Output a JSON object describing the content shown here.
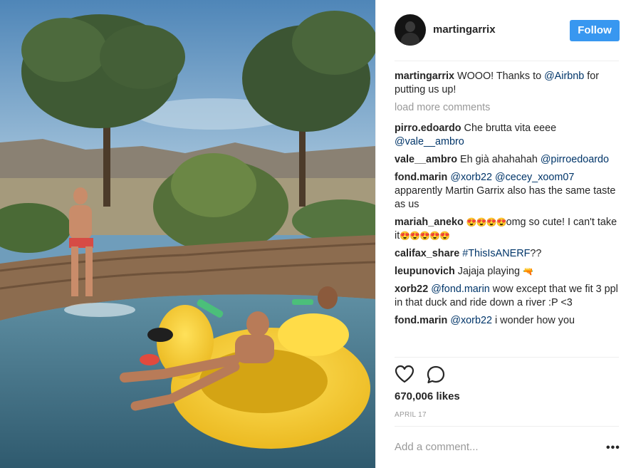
{
  "post": {
    "username": "martingarrix",
    "follow_label": "Follow",
    "caption": {
      "user": "martingarrix",
      "text_before": "WOOO! Thanks to ",
      "mention": "@Airbnb",
      "text_after": " for putting us up!"
    },
    "load_more": "load more comments",
    "comments": [
      {
        "user": "pirro.edoardo",
        "parts": [
          {
            "t": "text",
            "v": "Che brutta vita eeee "
          },
          {
            "t": "mention",
            "v": "@vale__ambro"
          }
        ]
      },
      {
        "user": "vale__ambro",
        "parts": [
          {
            "t": "text",
            "v": "Eh già ahahahah "
          },
          {
            "t": "mention",
            "v": "@pirroedoardo"
          }
        ]
      },
      {
        "user": "fond.marin",
        "parts": [
          {
            "t": "mention",
            "v": "@xorb22"
          },
          {
            "t": "text",
            "v": " "
          },
          {
            "t": "mention",
            "v": "@cecey_xoom07"
          },
          {
            "t": "text",
            "v": " apparently Martin Garrix also has the same taste as us"
          }
        ]
      },
      {
        "user": "mariah_aneko",
        "parts": [
          {
            "t": "emoji",
            "v": "😍😍😍😍"
          },
          {
            "t": "text",
            "v": "omg so cute! I can't take it"
          },
          {
            "t": "emoji",
            "v": "😍😍😍😍😍"
          }
        ]
      },
      {
        "user": "califax_share",
        "parts": [
          {
            "t": "mention",
            "v": "#ThisIsANERF"
          },
          {
            "t": "text",
            "v": "??"
          }
        ]
      },
      {
        "user": "leupunovich",
        "parts": [
          {
            "t": "text",
            "v": "Jajaja playing "
          },
          {
            "t": "emoji",
            "v": "🔫"
          }
        ]
      },
      {
        "user": "xorb22",
        "parts": [
          {
            "t": "mention",
            "v": "@fond.marin"
          },
          {
            "t": "text",
            "v": " wow except that we fit 3 ppl in that duck and ride down a river :P <3"
          }
        ]
      },
      {
        "user": "fond.marin",
        "parts": [
          {
            "t": "mention",
            "v": "@xorb22"
          },
          {
            "t": "text",
            "v": " i wonder how you"
          }
        ]
      }
    ],
    "likes": "670,006 likes",
    "date": "APRIL 17",
    "add_comment_placeholder": "Add a comment...",
    "more_options": "•••",
    "icons": {
      "like": "heart-icon",
      "comment": "comment-bubble-icon",
      "more": "more-options-icon"
    },
    "colors": {
      "follow_button": "#3897f0",
      "mention": "#003569",
      "muted": "#999999"
    }
  }
}
